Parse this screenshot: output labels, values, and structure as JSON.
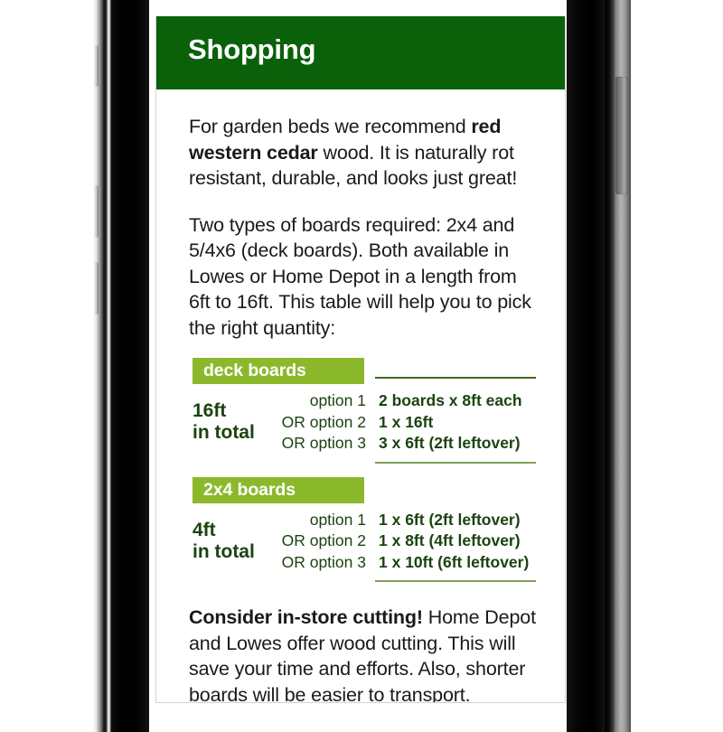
{
  "app": {
    "header_title": "Shopping",
    "header_color": "#0a610a",
    "label_color": "#8cb82b",
    "table_text_color": "#1b4310",
    "body_text_color": "#1a1a1a"
  },
  "paragraphs": {
    "intro": {
      "part1": "For garden beds we recommend ",
      "bold1": "red western cedar",
      "part2": " wood. It is naturally rot resistant, durable, and looks just great!"
    },
    "boards_info": "Two types of boards required: 2x4 and 5/4x6 (deck boards). Both available in Lowes or Home Depot in a length from 6ft to 16ft. This table will help you to pick the right quantity:",
    "cutting": {
      "bold1": "Consider in-store cutting!",
      "part2": " Home Depot and Lowes offer wood cutting. This will save your time and efforts. Also, shorter boards will be easier to transport."
    }
  },
  "tables": [
    {
      "label": "deck boards",
      "total_amount": "16ft",
      "total_suffix": "in total",
      "options": [
        "option 1",
        "OR option 2",
        "OR option 3"
      ],
      "values": [
        "2 boards x 8ft each",
        "1 x 16ft",
        "3 x 6ft (2ft leftover)"
      ]
    },
    {
      "label": "2x4 boards",
      "total_amount": "4ft",
      "total_suffix": "in total",
      "options": [
        "option 1",
        "OR option 2",
        "OR option 3"
      ],
      "values": [
        "1 x 6ft (2ft leftover)",
        "1 x 8ft (4ft leftover)",
        "1 x 10ft (6ft leftover)"
      ]
    }
  ]
}
